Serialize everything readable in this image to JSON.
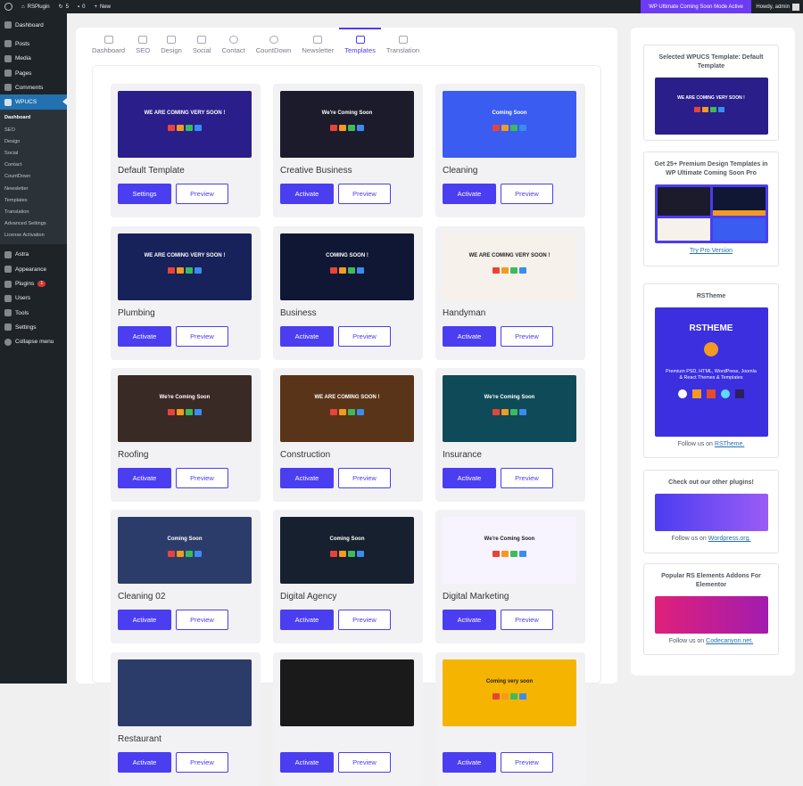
{
  "admin_bar": {
    "site_name": "RSPlugin",
    "updates_count": "5",
    "comments_count": "0",
    "new_label": "New",
    "notice": "WP Ultimate Coming Soon Mode Active",
    "howdy": "Howdy, admin"
  },
  "sidebar": {
    "items_top": [
      {
        "label": "Dashboard",
        "icon": "dashboard-icon"
      }
    ],
    "items_mid": [
      {
        "label": "Posts",
        "icon": "pin-icon"
      },
      {
        "label": "Media",
        "icon": "media-icon"
      },
      {
        "label": "Pages",
        "icon": "page-icon"
      },
      {
        "label": "Comments",
        "icon": "comment-icon"
      }
    ],
    "active": {
      "label": "WPUCS",
      "icon": "plugin-menu-icon"
    },
    "submenu": [
      "Dashboard",
      "SEO",
      "Design",
      "Social",
      "Contact",
      "CountDown",
      "Newsletter",
      "Templates",
      "Translation",
      "Advanced Settings",
      "License Activation"
    ],
    "items_bottom": [
      {
        "label": "Astra",
        "icon": "astra-icon"
      },
      {
        "label": "Appearance",
        "icon": "brush-icon"
      },
      {
        "label": "Plugins",
        "icon": "plug-icon",
        "badge": "1"
      },
      {
        "label": "Users",
        "icon": "user-icon"
      },
      {
        "label": "Tools",
        "icon": "wrench-icon"
      },
      {
        "label": "Settings",
        "icon": "settings-icon"
      },
      {
        "label": "Collapse menu",
        "icon": "collapse-icon"
      }
    ]
  },
  "tabs": [
    {
      "label": "Dashboard",
      "icon": "home-icon"
    },
    {
      "label": "SEO",
      "icon": "seo-icon"
    },
    {
      "label": "Design",
      "icon": "design-icon"
    },
    {
      "label": "Social",
      "icon": "share-icon"
    },
    {
      "label": "Contact",
      "icon": "info-icon"
    },
    {
      "label": "CountDown",
      "icon": "clock-icon"
    },
    {
      "label": "Newsletter",
      "icon": "mail-icon"
    },
    {
      "label": "Templates",
      "icon": "templates-icon",
      "active": true
    },
    {
      "label": "Translation",
      "icon": "translate-icon"
    }
  ],
  "templates": [
    {
      "name": "Default Template",
      "button": "Settings",
      "preview": "Preview",
      "bg": "#2a1e8a",
      "headline": "WE ARE COMING VERY SOON !"
    },
    {
      "name": "Creative Business",
      "button": "Activate",
      "preview": "Preview",
      "bg": "#1b1b2b",
      "headline": "We're Coming Soon"
    },
    {
      "name": "Cleaning",
      "button": "Activate",
      "preview": "Preview",
      "bg": "#3a5cf0",
      "headline": "Coming Soon"
    },
    {
      "name": "Plumbing",
      "button": "Activate",
      "preview": "Preview",
      "bg": "#17215a",
      "headline": "WE ARE COMING VERY SOON !"
    },
    {
      "name": "Business",
      "button": "Activate",
      "preview": "Preview",
      "bg": "#0f1734",
      "headline": "COMING SOON !"
    },
    {
      "name": "Handyman",
      "button": "Activate",
      "preview": "Preview",
      "bg": "#f6f1ea",
      "headline": "WE ARE COMING VERY SOON !"
    },
    {
      "name": "Roofing",
      "button": "Activate",
      "preview": "Preview",
      "bg": "#3a2a26",
      "headline": "We're Coming Soon"
    },
    {
      "name": "Construction",
      "button": "Activate",
      "preview": "Preview",
      "bg": "#5a3418",
      "headline": "WE ARE COMING SOON !"
    },
    {
      "name": "Insurance",
      "button": "Activate",
      "preview": "Preview",
      "bg": "#0f4a58",
      "headline": "We're Coming Soon"
    },
    {
      "name": "Cleaning 02",
      "button": "Activate",
      "preview": "Preview",
      "bg": "#2c3c6a",
      "headline": "Coming Soon"
    },
    {
      "name": "Digital Agency",
      "button": "Activate",
      "preview": "Preview",
      "bg": "#16202e",
      "headline": "Coming Soon"
    },
    {
      "name": "Digital Marketing",
      "button": "Activate",
      "preview": "Preview",
      "bg": "#f7f3ff",
      "headline": "We're Coming Soon"
    },
    {
      "name": "Restaurant",
      "button": "Activate",
      "preview": "Preview",
      "bg": "#2c3c6a",
      "headline": ""
    },
    {
      "name": "",
      "button": "Activate",
      "preview": "Preview",
      "bg": "#1a1a1a",
      "headline": ""
    },
    {
      "name": "",
      "button": "Activate",
      "preview": "Preview",
      "bg": "#f5b400",
      "headline": "Coming very soon"
    }
  ],
  "right": {
    "selected_title": "Selected WPUCS Template: Default Template",
    "pro_title": "Get 25+ Premium Design Templates in WP Ultimate Coming Soon Pro",
    "pro_link": "Try Pro Version",
    "rstheme_title": "RSTheme",
    "rstheme_banner": "RSTHEME",
    "rstheme_text": "Premium PSD, HTML, WordPress, Joomla & React Themes & Templates",
    "rstheme_follow": "Follow us on",
    "rstheme_link": "RSTheme.",
    "plugins_title": "Check out our other plugins!",
    "plugins_follow": "Follow us on",
    "plugins_link": "Wordpress.org.",
    "addons_title": "Popular RS Elements Addons For Elementor",
    "addons_follow": "Follow us on",
    "addons_link": "Codecanyon.net."
  },
  "colors": {
    "accent": "#4b3df0",
    "wp_admin": "#1d2327",
    "wp_active": "#2271b1",
    "notice": "#6c3bf3"
  }
}
